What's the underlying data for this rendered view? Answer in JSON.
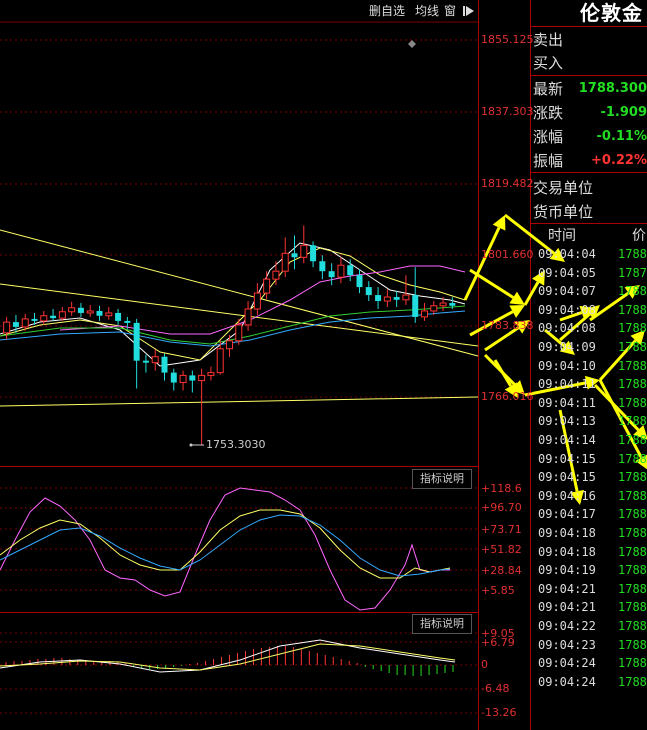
{
  "toolbar": {
    "delete_watch_label": "删自选",
    "ma_label": "均线",
    "window_label": "窗"
  },
  "panel": {
    "instrument": "伦敦金",
    "rows": [
      {
        "label": "卖出",
        "value": ""
      },
      {
        "label": "买入",
        "value": ""
      },
      {
        "label": "最新",
        "value": "1788.300"
      },
      {
        "label": "涨跌",
        "value": "-1.909"
      },
      {
        "label": "涨幅",
        "value": "-0.11%"
      },
      {
        "label": "振幅",
        "value": "+0.22%"
      },
      {
        "label": "交易单位",
        "value": ""
      },
      {
        "label": "货币单位",
        "value": ""
      }
    ],
    "ticks_header": {
      "time": "时间",
      "price": "价"
    },
    "ticks": [
      {
        "time": "09:04:04",
        "price": "1788"
      },
      {
        "time": "09:04:05",
        "price": "1787"
      },
      {
        "time": "09:04:07",
        "price": "1788"
      },
      {
        "time": "09:04:08",
        "price": "1788"
      },
      {
        "time": "09:04:08",
        "price": "1788"
      },
      {
        "time": "09:04:09",
        "price": "1788"
      },
      {
        "time": "09:04:10",
        "price": "1788"
      },
      {
        "time": "09:04:11",
        "price": "1788"
      },
      {
        "time": "09:04:11",
        "price": "1788"
      },
      {
        "time": "09:04:13",
        "price": "1788"
      },
      {
        "time": "09:04:14",
        "price": "1788"
      },
      {
        "time": "09:04:15",
        "price": "1788"
      },
      {
        "time": "09:04:15",
        "price": "1788"
      },
      {
        "time": "09:04:16",
        "price": "1788"
      },
      {
        "time": "09:04:17",
        "price": "1788"
      },
      {
        "time": "09:04:18",
        "price": "1788"
      },
      {
        "time": "09:04:18",
        "price": "1788"
      },
      {
        "time": "09:04:19",
        "price": "1788"
      },
      {
        "time": "09:04:21",
        "price": "1788"
      },
      {
        "time": "09:04:21",
        "price": "1788"
      },
      {
        "time": "09:04:22",
        "price": "1788"
      },
      {
        "time": "09:04:23",
        "price": "1788"
      },
      {
        "time": "09:04:24",
        "price": "1788"
      },
      {
        "time": "09:04:24",
        "price": "1788"
      }
    ]
  },
  "main_axis": [
    "1855.125",
    "1837.303",
    "1819.482",
    "1801.660",
    "1783.838",
    "1766.016"
  ],
  "low_price_label": "1753.3030",
  "indicator1": {
    "button_label": "指标说明",
    "axis": [
      "+118.6",
      "+96.70",
      "+73.71",
      "+51.82",
      "+28.84",
      "+5.85"
    ]
  },
  "indicator2": {
    "button_label": "指标说明",
    "axis": [
      "+9.05",
      "+6.79",
      "0",
      "-6.48",
      "-13.26"
    ]
  },
  "colors": {
    "up": "#ff3333",
    "down": "#22dddd",
    "grid": "#7a0000",
    "ma_yellow": "#ffff66",
    "ma_white": "#ffffff",
    "ma_magenta": "#ff66ff",
    "ma_green": "#33cc33",
    "ma_cyan": "#33aaff",
    "arrow": "#ffff00",
    "tick_green": "#22dd22"
  },
  "chart_data": {
    "type": "candlestick",
    "y_range": [
      1753.3,
      1855.125
    ],
    "candles": [
      {
        "o": 1781.5,
        "c": 1784.2,
        "h": 1785.5,
        "l": 1779.8
      },
      {
        "o": 1784.2,
        "c": 1783.0,
        "h": 1786.0,
        "l": 1781.5
      },
      {
        "o": 1783.0,
        "c": 1785.0,
        "h": 1786.3,
        "l": 1782.0
      },
      {
        "o": 1785.0,
        "c": 1784.5,
        "h": 1786.5,
        "l": 1783.5
      },
      {
        "o": 1784.5,
        "c": 1785.8,
        "h": 1787.0,
        "l": 1783.5
      },
      {
        "o": 1785.8,
        "c": 1785.2,
        "h": 1787.5,
        "l": 1784.5
      },
      {
        "o": 1785.2,
        "c": 1786.8,
        "h": 1788.0,
        "l": 1784.5
      },
      {
        "o": 1786.8,
        "c": 1787.8,
        "h": 1789.3,
        "l": 1785.8
      },
      {
        "o": 1787.8,
        "c": 1786.5,
        "h": 1789.0,
        "l": 1785.5
      },
      {
        "o": 1786.5,
        "c": 1787.0,
        "h": 1788.5,
        "l": 1785.5
      },
      {
        "o": 1787.0,
        "c": 1785.8,
        "h": 1788.3,
        "l": 1784.5
      },
      {
        "o": 1785.8,
        "c": 1786.5,
        "h": 1788.0,
        "l": 1784.8
      },
      {
        "o": 1786.5,
        "c": 1784.5,
        "h": 1787.5,
        "l": 1783.5
      },
      {
        "o": 1784.5,
        "c": 1784.0,
        "h": 1785.5,
        "l": 1782.5
      },
      {
        "o": 1784.0,
        "c": 1774.5,
        "h": 1785.0,
        "l": 1767.5
      },
      {
        "o": 1774.5,
        "c": 1774.0,
        "h": 1776.0,
        "l": 1771.5
      },
      {
        "o": 1774.0,
        "c": 1775.5,
        "h": 1777.3,
        "l": 1772.0
      },
      {
        "o": 1775.5,
        "c": 1771.5,
        "h": 1776.3,
        "l": 1769.5
      },
      {
        "o": 1771.5,
        "c": 1769.0,
        "h": 1772.5,
        "l": 1767.0
      },
      {
        "o": 1769.0,
        "c": 1770.8,
        "h": 1772.0,
        "l": 1767.0
      },
      {
        "o": 1770.8,
        "c": 1769.5,
        "h": 1772.0,
        "l": 1766.5
      },
      {
        "o": 1769.5,
        "c": 1770.8,
        "h": 1772.5,
        "l": 1753.3
      },
      {
        "o": 1770.8,
        "c": 1771.5,
        "h": 1773.0,
        "l": 1769.5
      },
      {
        "o": 1771.5,
        "c": 1777.5,
        "h": 1779.5,
        "l": 1771.0
      },
      {
        "o": 1777.5,
        "c": 1779.5,
        "h": 1781.0,
        "l": 1775.5
      },
      {
        "o": 1779.5,
        "c": 1783.5,
        "h": 1785.0,
        "l": 1778.5
      },
      {
        "o": 1783.5,
        "c": 1787.5,
        "h": 1789.5,
        "l": 1782.0
      },
      {
        "o": 1787.5,
        "c": 1791.5,
        "h": 1794.0,
        "l": 1786.0
      },
      {
        "o": 1791.5,
        "c": 1795.0,
        "h": 1797.0,
        "l": 1790.0
      },
      {
        "o": 1795.0,
        "c": 1797.0,
        "h": 1799.5,
        "l": 1793.5
      },
      {
        "o": 1797.0,
        "c": 1801.5,
        "h": 1805.5,
        "l": 1795.5
      },
      {
        "o": 1801.5,
        "c": 1800.5,
        "h": 1806.0,
        "l": 1797.5
      },
      {
        "o": 1800.5,
        "c": 1803.5,
        "h": 1808.5,
        "l": 1799.0
      },
      {
        "o": 1803.5,
        "c": 1799.5,
        "h": 1804.5,
        "l": 1798.0
      },
      {
        "o": 1799.5,
        "c": 1797.0,
        "h": 1801.0,
        "l": 1795.0
      },
      {
        "o": 1797.0,
        "c": 1795.5,
        "h": 1799.0,
        "l": 1793.5
      },
      {
        "o": 1795.5,
        "c": 1798.5,
        "h": 1800.5,
        "l": 1794.0
      },
      {
        "o": 1798.5,
        "c": 1796.0,
        "h": 1800.0,
        "l": 1794.5
      },
      {
        "o": 1796.0,
        "c": 1793.0,
        "h": 1797.5,
        "l": 1791.5
      },
      {
        "o": 1793.0,
        "c": 1791.0,
        "h": 1794.5,
        "l": 1789.5
      },
      {
        "o": 1791.0,
        "c": 1789.5,
        "h": 1793.0,
        "l": 1787.5
      },
      {
        "o": 1789.5,
        "c": 1790.5,
        "h": 1792.5,
        "l": 1788.0
      },
      {
        "o": 1790.5,
        "c": 1789.8,
        "h": 1792.0,
        "l": 1788.0
      },
      {
        "o": 1789.8,
        "c": 1791.0,
        "h": 1796.0,
        "l": 1788.5
      },
      {
        "o": 1791.0,
        "c": 1785.5,
        "h": 1798.0,
        "l": 1784.0
      },
      {
        "o": 1785.5,
        "c": 1787.0,
        "h": 1789.0,
        "l": 1784.5
      },
      {
        "o": 1787.0,
        "c": 1788.3,
        "h": 1789.5,
        "l": 1786.0
      },
      {
        "o": 1788.3,
        "c": 1789.0,
        "h": 1790.5,
        "l": 1787.0
      },
      {
        "o": 1789.0,
        "c": 1788.3,
        "h": 1790.5,
        "l": 1787.5
      }
    ]
  }
}
